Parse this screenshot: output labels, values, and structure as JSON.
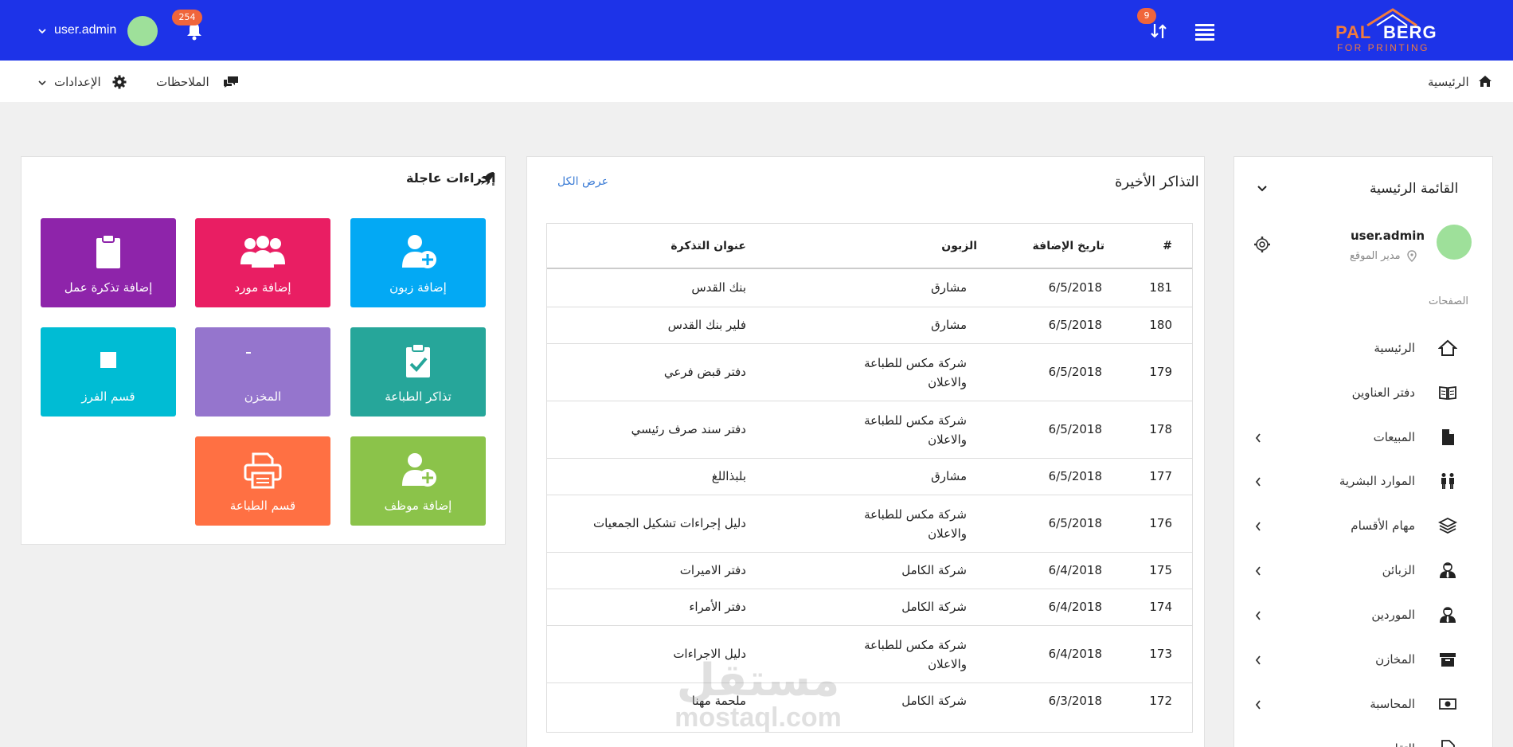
{
  "topbar": {
    "logo_main_a": "PAL",
    "logo_main_b": "BERG",
    "logo_sub": "FOR PRINTING",
    "sync_badge": "9",
    "bell_badge": "254",
    "user_name": "user.admin",
    "colors": {
      "bar": "#1d33e8",
      "badge": "#f0653b",
      "avatar": "#9ee09a"
    }
  },
  "subbar": {
    "breadcrumb": "الرئيسية",
    "notes": "الملاحظات",
    "settings": "الإعدادات"
  },
  "sidebar": {
    "title": "القائمة الرئيسية",
    "user_name": "user.admin",
    "user_role": "مدير الموقع",
    "section_label": "الصفحات",
    "items": [
      {
        "label": "الرئيسية",
        "icon": "home-outline-icon",
        "has_children": false
      },
      {
        "label": "دفتر العناوين",
        "icon": "open-book-icon",
        "has_children": false
      },
      {
        "label": "المبيعات",
        "icon": "file-icon",
        "has_children": true
      },
      {
        "label": "الموارد البشرية",
        "icon": "people-icon",
        "has_children": true
      },
      {
        "label": "مهام الأقسام",
        "icon": "layers-icon",
        "has_children": true
      },
      {
        "label": "الزبائن",
        "icon": "user-tie-icon",
        "has_children": true
      },
      {
        "label": "الموردين",
        "icon": "user-tie-icon",
        "has_children": true
      },
      {
        "label": "المخازن",
        "icon": "archive-icon",
        "has_children": true
      },
      {
        "label": "المحاسبة",
        "icon": "money-icon",
        "has_children": true
      },
      {
        "label": "التقا",
        "icon": "file-chart-icon",
        "has_children": false
      }
    ]
  },
  "tickets": {
    "title": "التذاكر الأخيرة",
    "view_all": "عرض الكل",
    "columns": {
      "num": "#",
      "date": "تاريخ الإضافة",
      "customer": "الزبون",
      "subject": "عنوان التذكرة"
    },
    "rows": [
      {
        "num": "181",
        "date": "6/5/2018",
        "customer": "مشارق",
        "subject": "بنك القدس"
      },
      {
        "num": "180",
        "date": "6/5/2018",
        "customer": "مشارق",
        "subject": "فلير بنك القدس"
      },
      {
        "num": "179",
        "date": "6/5/2018",
        "customer": "شركة مكس للطباعة والاعلان",
        "subject": "دفتر قبض فرعي"
      },
      {
        "num": "178",
        "date": "6/5/2018",
        "customer": "شركة مكس للطباعة والاعلان",
        "subject": "دفتر سند صرف رئيسي"
      },
      {
        "num": "177",
        "date": "6/5/2018",
        "customer": "مشارق",
        "subject": "بلبذاللغ"
      },
      {
        "num": "176",
        "date": "6/5/2018",
        "customer": "شركة مكس للطباعة والاعلان",
        "subject": "دليل إجراءات تشكيل الجمعيات"
      },
      {
        "num": "175",
        "date": "6/4/2018",
        "customer": "شركة الكامل",
        "subject": "دفتر الاميرات"
      },
      {
        "num": "174",
        "date": "6/4/2018",
        "customer": "شركة الكامل",
        "subject": "دفتر الأمراء"
      },
      {
        "num": "173",
        "date": "6/4/2018",
        "customer": "شركة مكس للطباعة والاعلان",
        "subject": "دليل الاجراءات"
      },
      {
        "num": "172",
        "date": "6/3/2018",
        "customer": "شركة الكامل",
        "subject": "ملحمة مهنا"
      }
    ]
  },
  "quick_actions": {
    "title": "إجراءات عاجلة",
    "tiles": [
      {
        "label": "إضافة زبون",
        "icon": "add-user-icon",
        "color": "#03a9f4"
      },
      {
        "label": "إضافة مورد",
        "icon": "users-group-icon",
        "color": "#e91e63"
      },
      {
        "label": "إضافة تذكرة عمل",
        "icon": "clipboard-icon",
        "color": "#8e24aa"
      },
      {
        "label": "تذاكر الطباعة",
        "icon": "clipboard-check-icon",
        "color": "#26a69a"
      },
      {
        "label": "المخزن",
        "icon": "archive-icon",
        "color": "#9575cd"
      },
      {
        "label": "قسم الفرز",
        "icon": "square-icon",
        "color": "#00bcd4"
      },
      {
        "label": "إضافة موظف",
        "icon": "add-user-icon",
        "color": "#8bc34a"
      },
      {
        "label": "قسم الطباعة",
        "icon": "printer-icon",
        "color": "#ff7043"
      }
    ]
  },
  "watermark": {
    "line1": "مستقل",
    "line2": "mostaql.com"
  }
}
